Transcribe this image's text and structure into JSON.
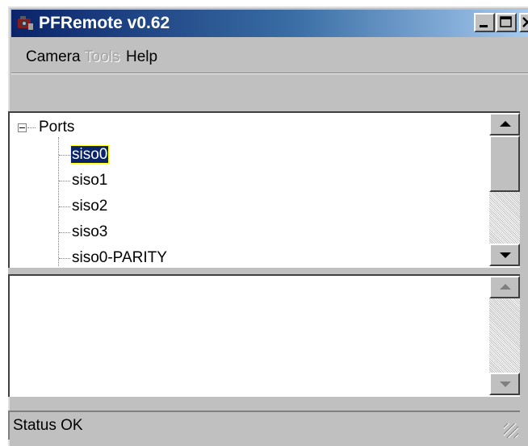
{
  "window": {
    "title": "PFRemote v0.62",
    "icon": "camera-app-icon"
  },
  "titlebar_buttons": {
    "minimize": "minimize-icon",
    "maximize": "maximize-icon",
    "close": "close-icon"
  },
  "menu": {
    "items": [
      {
        "label": "Camera",
        "enabled": true
      },
      {
        "label": "Tools",
        "enabled": false
      },
      {
        "label": "Help",
        "enabled": true
      }
    ]
  },
  "tree": {
    "root": {
      "label": "Ports",
      "expanded": true
    },
    "children": [
      {
        "label": "siso0",
        "selected": true
      },
      {
        "label": "siso1",
        "selected": false
      },
      {
        "label": "siso2",
        "selected": false
      },
      {
        "label": "siso3",
        "selected": false
      },
      {
        "label": "siso0-PARITY",
        "selected": false
      }
    ]
  },
  "status": {
    "text": "Status OK"
  },
  "colors": {
    "selection": "#0a246a",
    "titlebar_start": "#0a246a",
    "titlebar_end": "#a6caf0",
    "face": "#c0c0c0"
  }
}
